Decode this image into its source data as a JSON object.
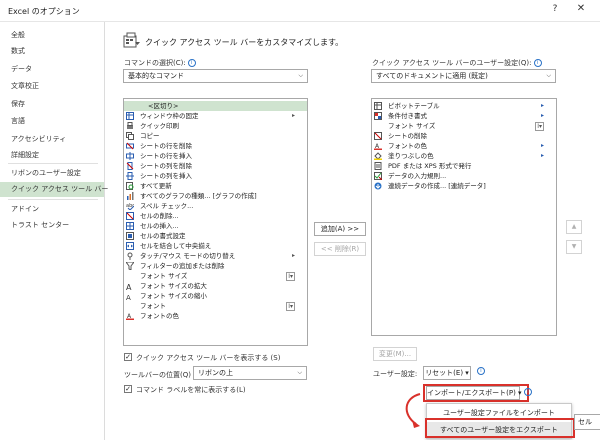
{
  "window": {
    "title": "Excel のオプション",
    "help": "?",
    "close": "✕"
  },
  "sidebar": {
    "items": [
      {
        "label": "全般"
      },
      {
        "label": "数式"
      },
      {
        "label": "データ"
      },
      {
        "label": "文章校正"
      },
      {
        "label": "保存"
      },
      {
        "label": "言語"
      },
      {
        "label": "アクセシビリティ"
      },
      {
        "label": "詳細設定"
      },
      {
        "label": "リボンのユーザー設定"
      },
      {
        "label": "クイック アクセス ツール バー"
      },
      {
        "label": "アドイン"
      },
      {
        "label": "トラスト センター"
      }
    ],
    "active_index": 9
  },
  "header": {
    "title": "クイック アクセス ツール バーをカスタマイズします。"
  },
  "left": {
    "choose_label": "コマンドの選択(C):",
    "choose_value": "基本的なコマンド",
    "commands": [
      {
        "label": "<区切り>",
        "icon": "separator-icon"
      },
      {
        "label": "ウィンドウ枠の固定",
        "icon": "freeze-panes-icon",
        "submenu": true
      },
      {
        "label": "クイック印刷",
        "icon": "quick-print-icon"
      },
      {
        "label": "コピー",
        "icon": "copy-icon"
      },
      {
        "label": "シートの行を削除",
        "icon": "delete-row-icon"
      },
      {
        "label": "シートの行を挿入",
        "icon": "insert-row-icon"
      },
      {
        "label": "シートの列を削除",
        "icon": "delete-column-icon"
      },
      {
        "label": "シートの列を挿入",
        "icon": "insert-column-icon"
      },
      {
        "label": "すべて更新",
        "icon": "refresh-all-icon"
      },
      {
        "label": "すべてのグラフの種類... [グラフの作成]",
        "icon": "chart-types-icon"
      },
      {
        "label": "スペル チェック...",
        "icon": "spell-check-icon"
      },
      {
        "label": "セルの削除...",
        "icon": "delete-cells-icon"
      },
      {
        "label": "セルの挿入...",
        "icon": "insert-cells-icon"
      },
      {
        "label": "セルの書式設定",
        "icon": "format-cells-icon"
      },
      {
        "label": "セルを結合して中央揃え",
        "icon": "merge-center-icon"
      },
      {
        "label": "タッチ/マウス モードの切り替え",
        "icon": "touch-mode-icon",
        "submenu": true
      },
      {
        "label": "フィルターの追加または削除",
        "icon": "filter-icon"
      },
      {
        "label": "フォント サイズ",
        "icon": "",
        "sideicon": "I▾"
      },
      {
        "label": "フォント サイズの拡大",
        "icon": "font-grow-icon"
      },
      {
        "label": "フォント サイズの縮小",
        "icon": "font-shrink-icon"
      },
      {
        "label": "フォント",
        "icon": "",
        "sideicon": "I▾"
      },
      {
        "label": "フォントの色",
        "icon": "font-color-icon"
      }
    ],
    "show_below_label": "クイック アクセス ツール バーを表示する (S)",
    "position_label": "ツールバーの位置(Q)",
    "position_value": "リボンの上",
    "always_labels": "コマンド ラベルを常に表示する(L)"
  },
  "middle": {
    "add": "追加(A) >>",
    "remove": "<< 削除(R)"
  },
  "right": {
    "customize_label": "クイック アクセス ツール バーのユーザー設定(Q):",
    "customize_value": "すべてのドキュメントに適用 (既定)",
    "commands": [
      {
        "label": "ピボットテーブル",
        "icon": "pivot-table-icon",
        "submenu": true
      },
      {
        "label": "条件付き書式",
        "icon": "conditional-format-icon",
        "submenu": true
      },
      {
        "label": "フォント サイズ",
        "icon": "",
        "sideicon": "I▾"
      },
      {
        "label": "シートの削除",
        "icon": "delete-sheet-icon"
      },
      {
        "label": "フォントの色",
        "icon": "font-color-icon",
        "submenu": true
      },
      {
        "label": "塗りつぶしの色",
        "icon": "fill-color-icon",
        "submenu": true
      },
      {
        "label": "PDF または XPS 形式で発行",
        "icon": "pdf-icon"
      },
      {
        "label": "データの入力規則...",
        "icon": "data-validation-icon"
      },
      {
        "label": "連続データの作成... [連続データ]",
        "icon": "fill-series-icon"
      }
    ],
    "modify": "変更(M)...",
    "user_settings_label": "ユーザー設定:",
    "reset": "リセット(E) ▾",
    "import_export": "インポート/エクスポート(P) ▾",
    "up": "▲",
    "down": "▼"
  },
  "dropdown_menu": {
    "item1": "ユーザー設定ファイルをインポート",
    "item2": "すべてのユーザー設定をエクスポート"
  },
  "footer": {
    "cancel_partial": "セル"
  },
  "colors": {
    "accent": "#cfe3cf",
    "highlight_red": "#d9312b",
    "brand": "#217346"
  }
}
